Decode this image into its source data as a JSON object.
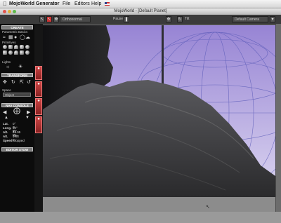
{
  "menubar": {
    "apple_icon": "apple-icon",
    "items": [
      "MojoWorld Generator",
      "File",
      "Editors",
      "Help"
    ]
  },
  "window": {
    "title": "MojoWorld - [Default Planet]"
  },
  "toolbar": {
    "view_select": "Orthonormal",
    "pause_label": "Pause",
    "tilt_label": "Tilt",
    "camera_select": "Default Camera"
  },
  "left_panel": {
    "create_header": "CREATE",
    "parametric_label": "Parametric Basics",
    "primitives_label": "Primitives",
    "lights_label": "Lights",
    "transform_header": "TRANSFORM",
    "space_label": "Space",
    "space_value": "Object",
    "nav_header": "NAV CONSOLE",
    "stats": [
      {
        "label": "Lat.",
        "value": "0° 0' 0\""
      },
      {
        "label": "Long.",
        "value": "90° 23' W"
      },
      {
        "label": "Alt.",
        "value": "21.95 Km"
      },
      {
        "label": "Alt.",
        "value": "1.03 m"
      },
      {
        "label": "Speed",
        "value": "Stopped"
      }
    ],
    "editor_header": "EDITOR STOW"
  },
  "colors": {
    "sky_top": "#9a86d6",
    "sky_bottom": "#d9d3ef",
    "terrain": "#3a3a3c",
    "red_accent": "#c44444",
    "panel_bg": "#0c0c0c"
  }
}
